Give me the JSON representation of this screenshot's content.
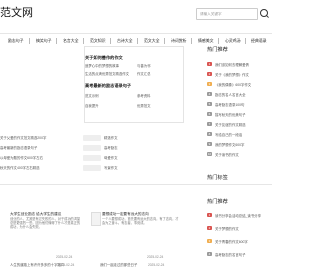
{
  "site": {
    "logo": "范文网"
  },
  "search": {
    "placeholder": "请输入关键字"
  },
  "nav": {
    "items": [
      "励志句子",
      "搞笑句子",
      "名言大全",
      "范文知识",
      "古诗大全",
      "范文大全",
      "诗词赏析",
      "情感美文",
      "心灵鸡汤",
      "经典语录"
    ]
  },
  "featured": {
    "heading_1": "关于如何善作的作文",
    "row_1": [
      "追梦心中的梦想的故事",
      "与善为邻"
    ],
    "row_2": [
      "生活的点滴优秀范文精选作文",
      "作文汇总"
    ],
    "heading_2": "高考最新的励志语录句子",
    "row_3": [
      "范文示例",
      "参考资料"
    ],
    "row_4": [
      "自我提升",
      "优秀范文"
    ]
  },
  "left_list": [
    {
      "text": "关于父爱的作文范文精选200字",
      "tag": "精选作文"
    },
    {
      "text": "高考最新的励志语录句子",
      "tag": "高考励志"
    },
    {
      "text": "以母爱为题的作文600字左右",
      "tag": "母爱作文"
    },
    {
      "text": "秋天的作文400字左右精选",
      "tag": "写景作文"
    }
  ],
  "sidebar": {
    "title": "热门推荐",
    "items": [
      {
        "label": "我们该如何去理解爱情",
        "rank": "1",
        "color": "#d9534f"
      },
      {
        "label": "关于《我的梦想》作文",
        "rank": "2",
        "color": "#d9534f"
      },
      {
        "label": "《我的偶像》600字作文",
        "rank": "3",
        "color": "#f0ad4e"
      },
      {
        "label": "励志的名人名言大全",
        "rank": "4",
        "color": "#999999"
      },
      {
        "label": "高考励志语录100句",
        "rank": "5",
        "color": "#999999"
      },
      {
        "label": "描写秋天的优美句子",
        "rank": "6",
        "color": "#999999"
      },
      {
        "label": "关于友谊的作文精选",
        "rank": "7",
        "color": "#999999"
      },
      {
        "label": "写给自己的一段话",
        "rank": "8",
        "color": "#999999"
      },
      {
        "label": "我的梦想作文600字",
        "rank": "9",
        "color": "#999999"
      },
      {
        "label": "关于读书的作文",
        "rank": "10",
        "color": "#999999"
      }
    ],
    "title_2": "热门标签",
    "tags_note": ""
  },
  "articles": [
    {
      "title": "大学生创业励志 给大学生的建议",
      "desc": "创业的人，尤其是有过失败的人，对于成功的渴望总是更强烈一些。因为他们懂得了什么才是真正的成功，为什么会失败。",
      "date": "2025-02-24"
    },
    {
      "title": "要想成功一定要有远大的志向",
      "desc": "一个人要想成功，首先要有远大的志向，有了志向，才会为之奋斗。有志者，事竟成。",
      "date": "2025-02-24"
    }
  ],
  "bottom_list": [
    {
      "text": "人生的道路上有许许多多的十字路口",
      "date": "2025-02-24"
    },
    {
      "text": "我们一起走过的那些日子",
      "date": "2025-02-24"
    }
  ],
  "sidebar_2": {
    "title": "热门推荐",
    "items": [
      {
        "label": "读书分享会活动总结_读书分享",
        "rank": "1",
        "color": "#d9534f"
      },
      {
        "label": "关于梦想的作文",
        "rank": "2",
        "color": "#d9534f"
      },
      {
        "label": "关于青春的作文600字",
        "rank": "3",
        "color": "#f0ad4e"
      },
      {
        "label": "高考励志的名言句子",
        "rank": "4",
        "color": "#999999"
      }
    ]
  }
}
